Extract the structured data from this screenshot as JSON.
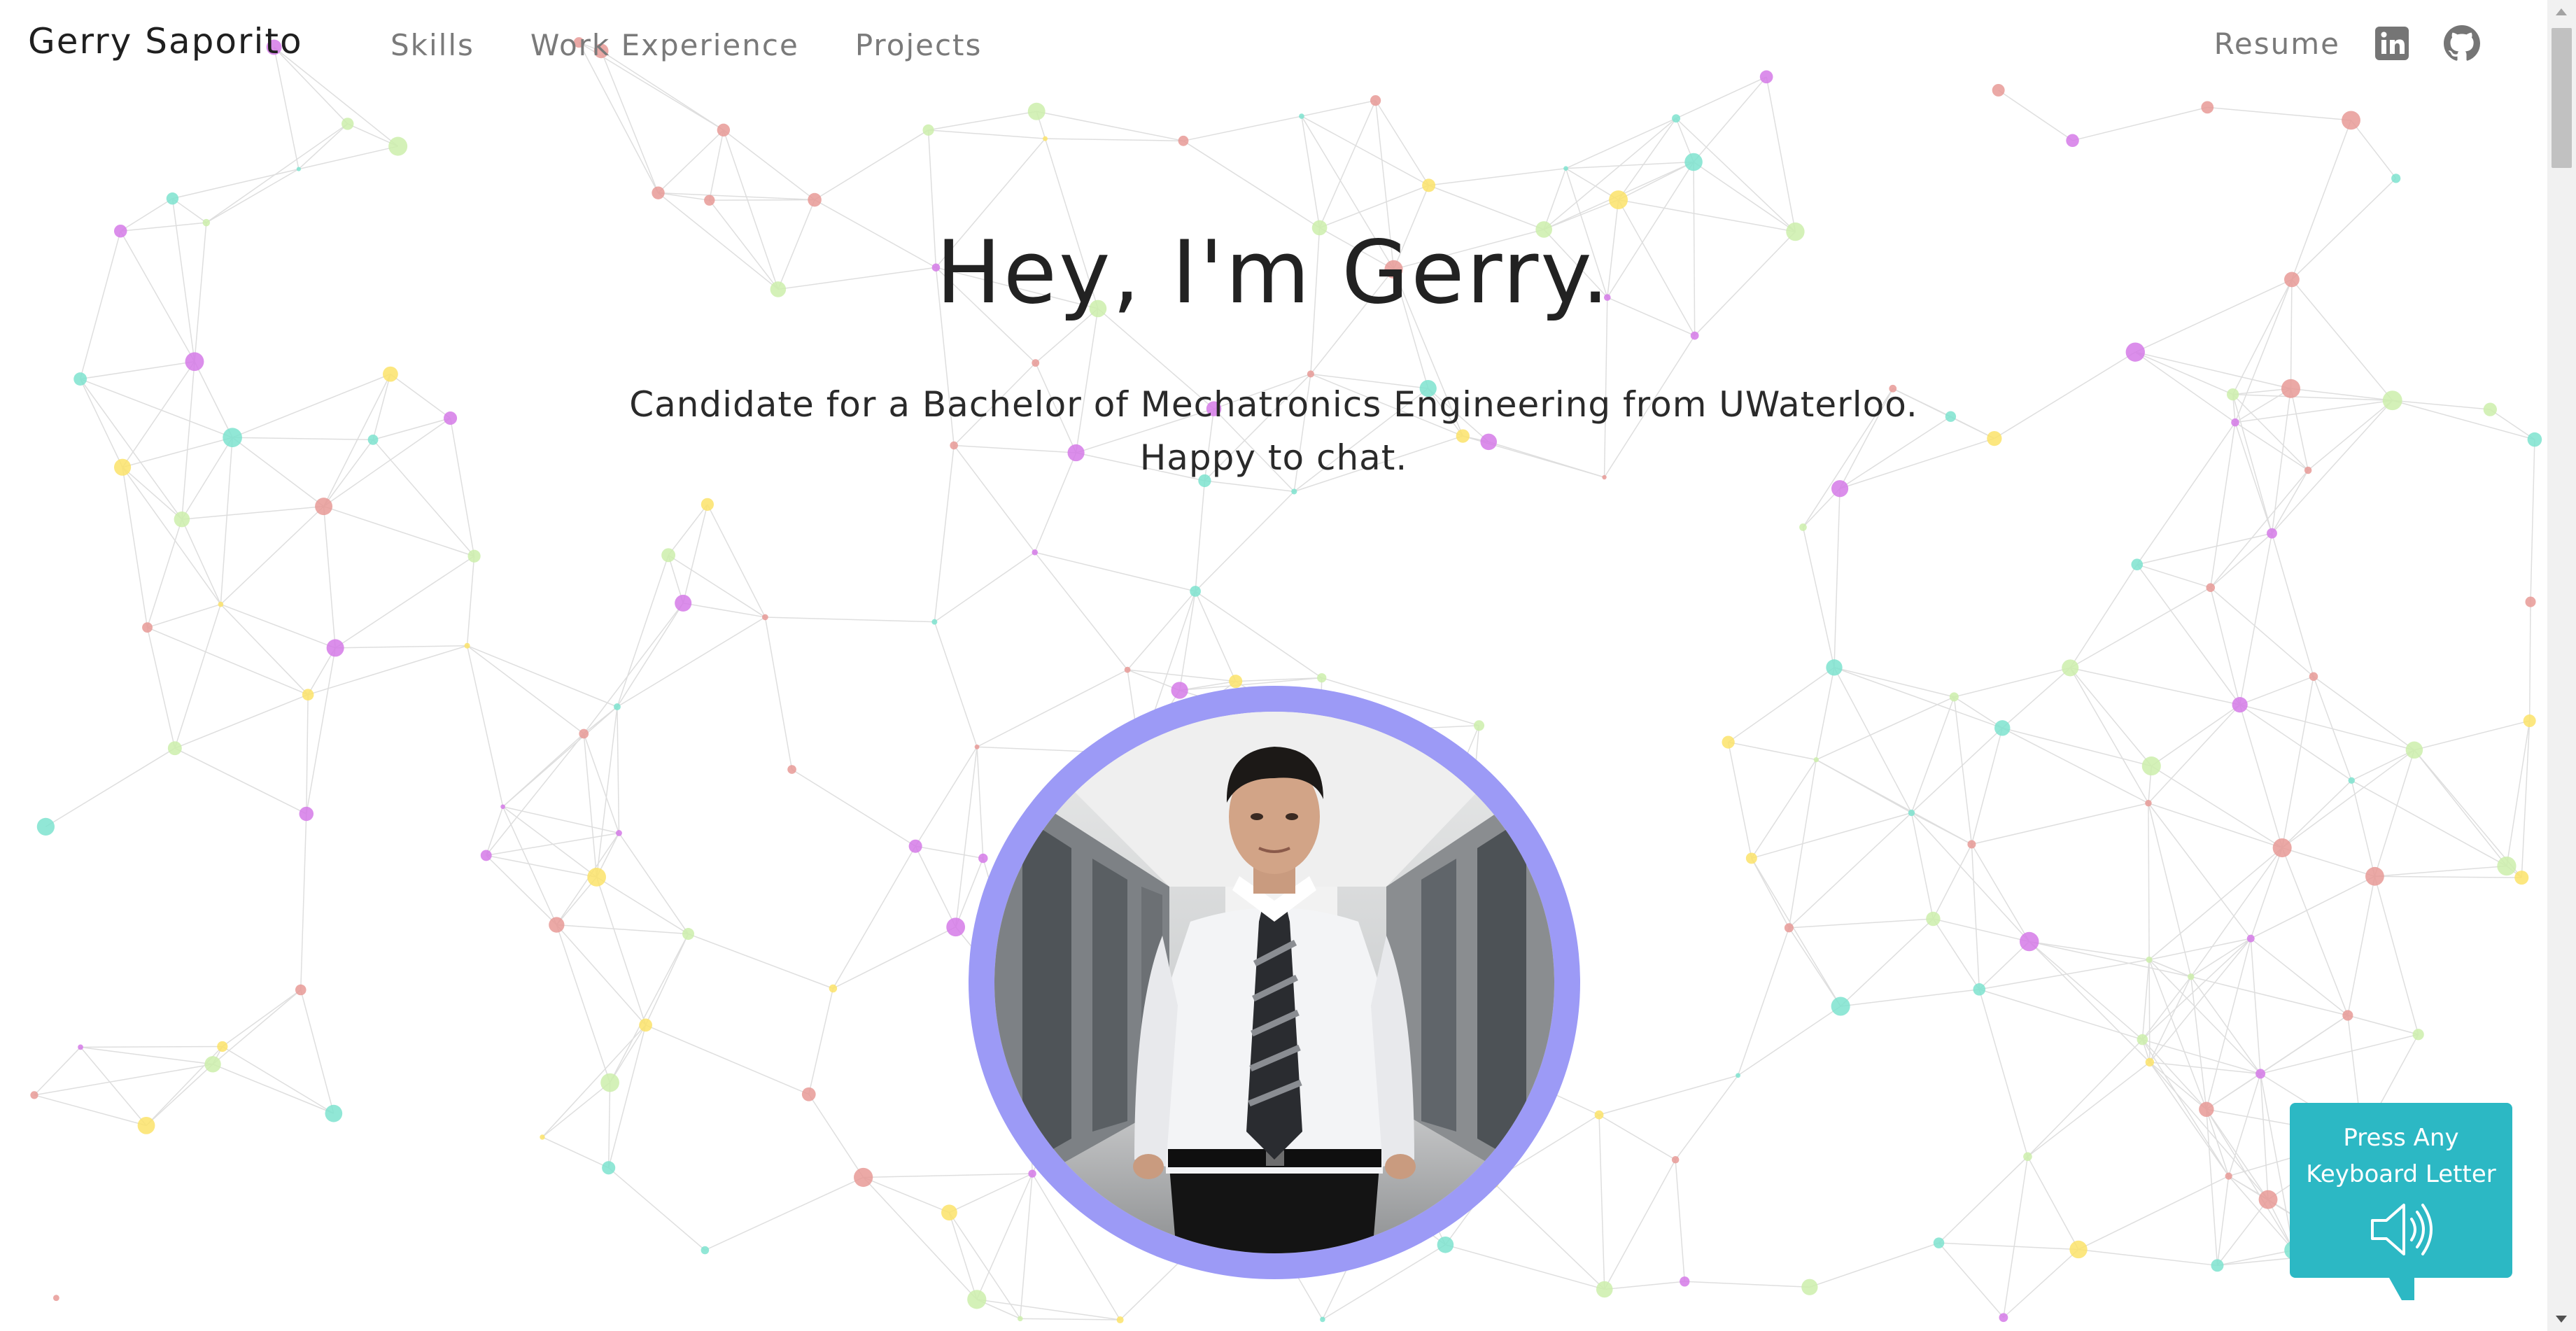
{
  "navbar": {
    "brand": "Gerry Saporito",
    "links": [
      {
        "label": "Skills"
      },
      {
        "label": "Work Experience"
      },
      {
        "label": "Projects"
      }
    ],
    "resume_label": "Resume",
    "social": [
      {
        "icon": "linkedin-icon"
      },
      {
        "icon": "github-icon"
      }
    ]
  },
  "hero": {
    "title": "Hey, I'm Gerry.",
    "subtitle_line1": "Candidate for a Bachelor of Mechatronics Engineering from UWaterloo.",
    "subtitle_line2": "Happy to chat."
  },
  "avatar": {
    "ring_color": "#9c9af6"
  },
  "sound_prompt": {
    "line1": "Press Any",
    "line2": "Keyboard Letter",
    "icon": "speaker-icon",
    "color": "#2cb8c4"
  },
  "background": {
    "palette": [
      "#e89a96",
      "#7ee3cf",
      "#fbe36a",
      "#d57ae8",
      "#cdeeab"
    ]
  }
}
